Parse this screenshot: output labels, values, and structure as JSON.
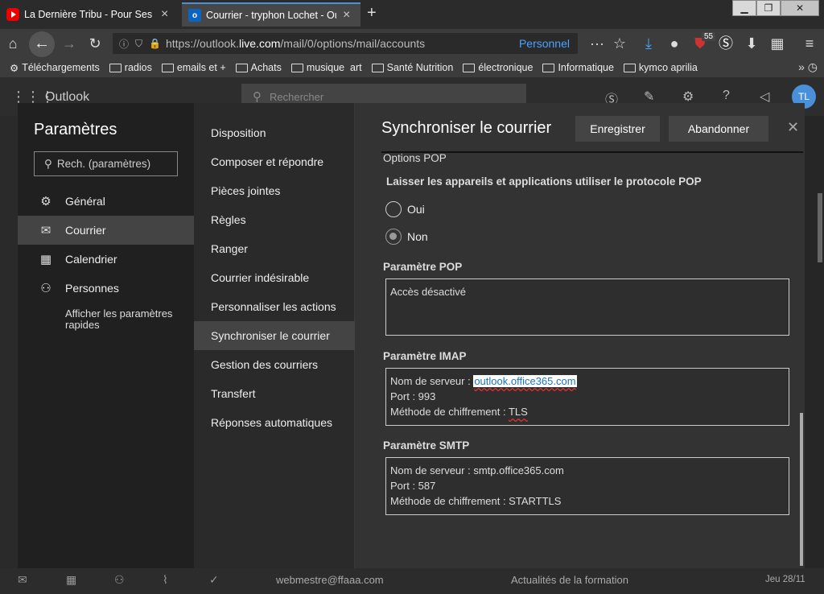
{
  "browser": {
    "tabs": [
      {
        "title": "La Dernière Tribu - Pour Ses Frè",
        "favicon": "youtube-icon"
      },
      {
        "title": "Courrier - tryphon Lochet - Outl",
        "favicon": "outlook-icon"
      }
    ],
    "url_prefix": "https://outlook.",
    "url_domain": "live.com",
    "url_path": "/mail/0/options/mail/accounts",
    "container": "Personnel",
    "extension_badge": "55",
    "bookmarks": [
      "Téléchargements",
      "radios",
      "emails et +",
      "Achats",
      "musique  art",
      "Santé Nutrition",
      "électronique",
      "Informatique",
      "kymco aprilia"
    ]
  },
  "outlook": {
    "brand": "Outlook",
    "search_placeholder": "Rechercher",
    "avatar_initials": "TL",
    "background_row": {
      "sender": "webmestre@ffaaa.com",
      "subject": "Actualités de la formation",
      "date": "Jeu 28/11"
    }
  },
  "settings": {
    "title": "Paramètres",
    "search_placeholder": "Rech. (paramètres)",
    "categories": [
      {
        "label": "Général",
        "icon": "gear-icon"
      },
      {
        "label": "Courrier",
        "icon": "mail-icon"
      },
      {
        "label": "Calendrier",
        "icon": "calendar-icon"
      },
      {
        "label": "Personnes",
        "icon": "people-icon"
      }
    ],
    "quick_settings": "Afficher les paramètres rapides",
    "subcategories": [
      "Disposition",
      "Composer et répondre",
      "Pièces jointes",
      "Règles",
      "Ranger",
      "Courrier indésirable",
      "Personnaliser les actions",
      "Synchroniser le courrier",
      "Gestion des courriers",
      "Transfert",
      "Réponses automatiques"
    ]
  },
  "panel": {
    "title": "Synchroniser le courrier",
    "save_label": "Enregistrer",
    "cancel_label": "Abandonner",
    "pop_options_label": "Options POP",
    "pop_question": "Laisser les appareils et applications utiliser le protocole POP",
    "radio_yes": "Oui",
    "radio_no": "Non",
    "radio_selected": "Non",
    "pop_setting_label": "Paramètre POP",
    "pop_setting_value": "Accès désactivé",
    "imap_label": "Paramètre IMAP",
    "imap_server_prefix": "Nom de serveur : ",
    "imap_server": "outlook.office365.com",
    "imap_port": "Port : 993",
    "imap_encryption_prefix": "Méthode de chiffrement : ",
    "imap_encryption": "TLS",
    "smtp_label": "Paramètre SMTP",
    "smtp_server": "Nom de serveur : smtp.office365.com",
    "smtp_port": "Port : 587",
    "smtp_encryption": "Méthode de chiffrement : STARTTLS"
  }
}
